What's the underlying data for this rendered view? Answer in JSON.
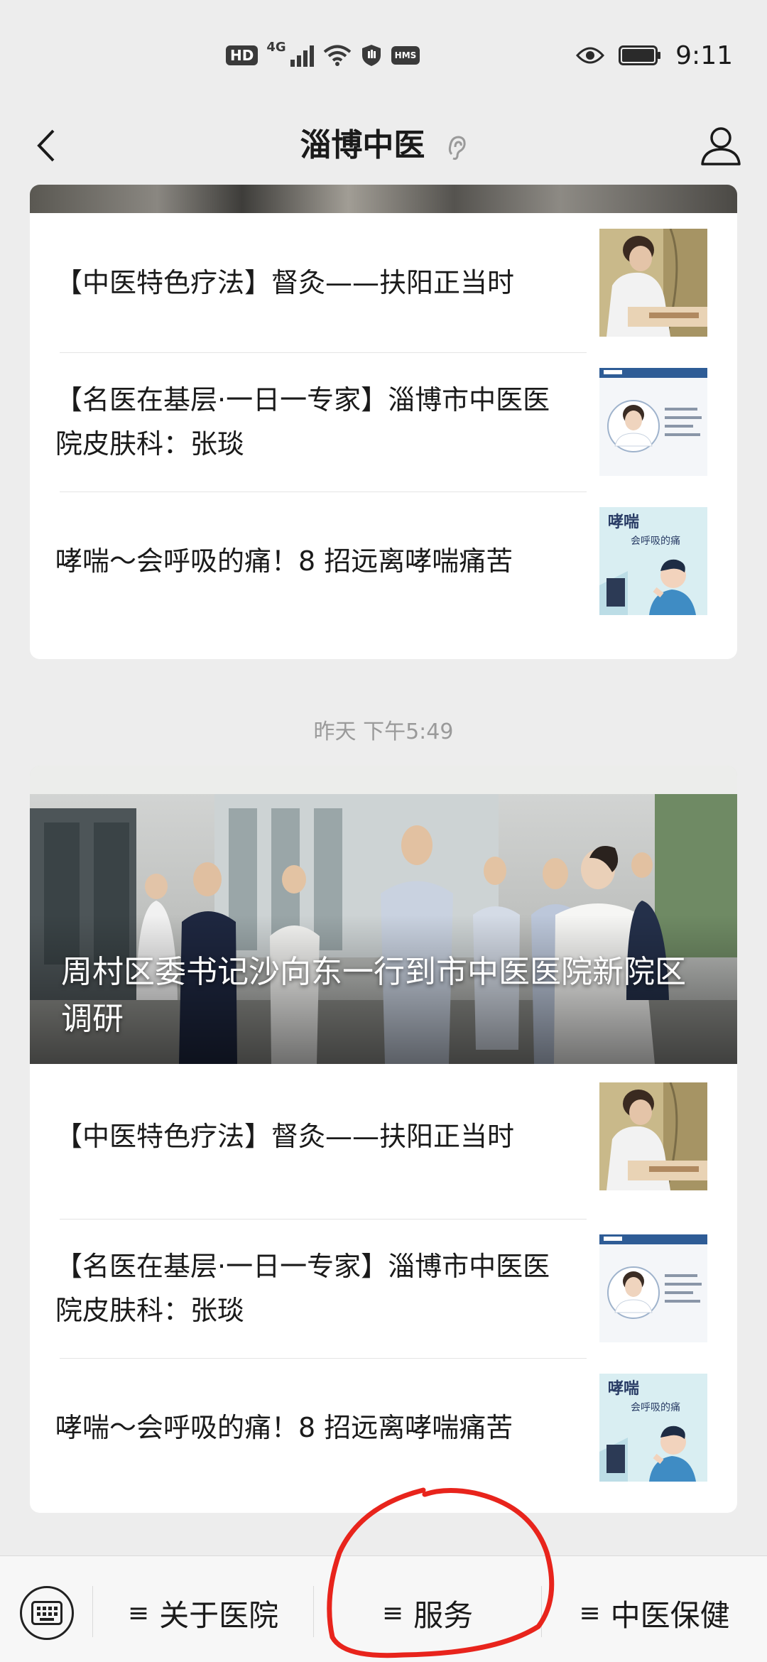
{
  "status_bar": {
    "hd_badge": "HD",
    "network": "4G",
    "hms_badge": "HMS",
    "time": "9:11"
  },
  "nav": {
    "title": "淄博中医"
  },
  "first_card": {
    "items": [
      {
        "title": "【中医特色疗法】督灸——扶阳正当时"
      },
      {
        "title_line1": "【名医在基层·一日一专家】淄博市中医医",
        "title_line2": "院皮肤科：张琰"
      },
      {
        "title": "哮喘～会呼吸的痛！8 招远离哮喘痛苦"
      }
    ]
  },
  "timestamp": "昨天 下午5:49",
  "second_card": {
    "hero_title": "周村区委书记沙向东一行到市中医医院新院区调研",
    "items": [
      {
        "title": "【中医特色疗法】督灸——扶阳正当时"
      },
      {
        "title_line1": "【名医在基层·一日一专家】淄博市中医医",
        "title_line2": "院皮肤科：张琰"
      },
      {
        "title": "哮喘～会呼吸的痛！8 招远离哮喘痛苦"
      }
    ]
  },
  "thumbnails": {
    "asthma_title": "哮喘",
    "asthma_sub": "会呼吸的痛"
  },
  "bottom_menu": {
    "items": [
      {
        "label": "关于医院"
      },
      {
        "label": "服务"
      },
      {
        "label": "中医保健"
      }
    ],
    "hamburger": "≡"
  },
  "colors": {
    "background": "#ededed",
    "annotation": "#e8241c"
  }
}
